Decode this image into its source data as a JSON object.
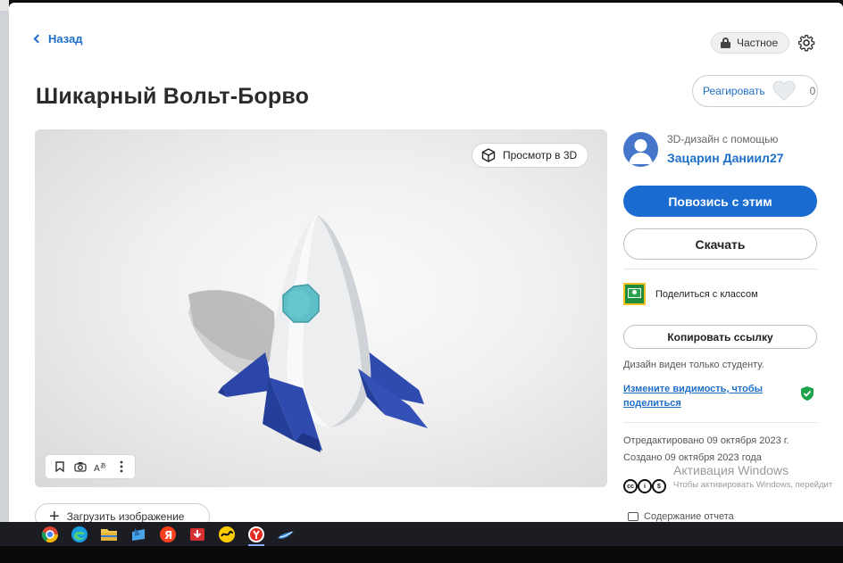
{
  "header": {
    "back_label": "Назад",
    "privacy_label": "Частное",
    "react_label": "Реагировать",
    "react_count": "0"
  },
  "design": {
    "title": "Шикарный Вольт-Борво",
    "view3d_label": "Просмотр в 3D",
    "upload_label": "Загрузить изображение"
  },
  "sidebar": {
    "author_sub": "3D-дизайн с помощью",
    "author_name": "Зацарин Даниил27",
    "tinker_label": "Повозись с этим",
    "download_label": "Скачать",
    "share_class_label": "Поделиться с классом",
    "copy_link_label": "Копировать ссылку",
    "visible_note": "Дизайн виден только студенту.",
    "change_visibility": "Измените видимость, чтобы поделиться",
    "edited": "Отредактировано 09 октября 2023 г.",
    "created": "Создано 09 октября 2023 года",
    "report_label": "Содержание отчета"
  },
  "os": {
    "watermark_title": "Активация Windows",
    "watermark_sub": "Чтобы активировать Windows, перейдит"
  },
  "colors": {
    "accent": "#1b6cd1",
    "link": "#1e6fc9",
    "rocket_body": "#eef0f2",
    "rocket_fins": "#2f4bb0",
    "porthole": "#5fbfc8"
  }
}
